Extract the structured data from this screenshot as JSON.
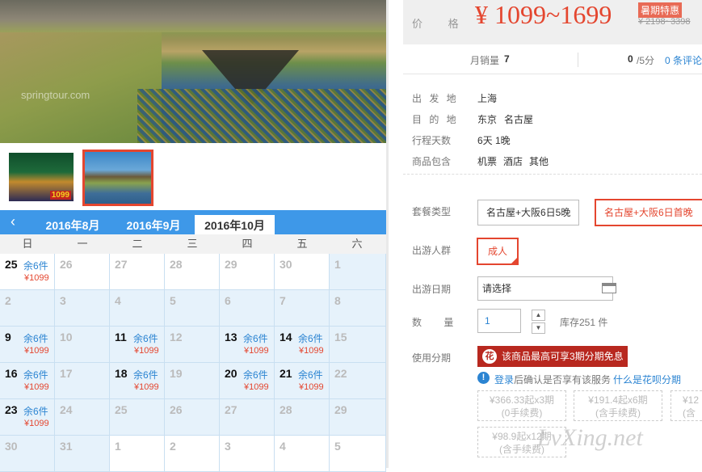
{
  "photo": {
    "watermark": "springtour.com"
  },
  "thumbs": [
    {
      "badge": "1099"
    },
    {
      "badge": ""
    }
  ],
  "calendar": {
    "tabs": [
      "2016年8月",
      "2016年9月",
      "2016年10月"
    ],
    "weekdays": [
      "日",
      "一",
      "二",
      "三",
      "四",
      "五",
      "六"
    ],
    "rows": [
      [
        {
          "d": "25",
          "s": "余6件",
          "p": "¥1099",
          "on": true,
          "w": true
        },
        {
          "d": "26",
          "w": true
        },
        {
          "d": "27",
          "w": true
        },
        {
          "d": "28",
          "w": true
        },
        {
          "d": "29",
          "w": true
        },
        {
          "d": "30",
          "w": true
        },
        {
          "d": "1"
        }
      ],
      [
        {
          "d": "2"
        },
        {
          "d": "3"
        },
        {
          "d": "4"
        },
        {
          "d": "5"
        },
        {
          "d": "6"
        },
        {
          "d": "7"
        },
        {
          "d": "8"
        }
      ],
      [
        {
          "d": "9",
          "s": "余6件",
          "p": "¥1099",
          "on": true
        },
        {
          "d": "10"
        },
        {
          "d": "11",
          "s": "余6件",
          "p": "¥1099",
          "on": true
        },
        {
          "d": "12"
        },
        {
          "d": "13",
          "s": "余6件",
          "p": "¥1099",
          "on": true
        },
        {
          "d": "14",
          "s": "余6件",
          "p": "¥1099",
          "on": true
        },
        {
          "d": "15"
        }
      ],
      [
        {
          "d": "16",
          "s": "余6件",
          "p": "¥1099",
          "on": true
        },
        {
          "d": "17"
        },
        {
          "d": "18",
          "s": "余6件",
          "p": "¥1099",
          "on": true
        },
        {
          "d": "19"
        },
        {
          "d": "20",
          "s": "余6件",
          "p": "¥1099",
          "on": true
        },
        {
          "d": "21",
          "s": "余6件",
          "p": "¥1099",
          "on": true
        },
        {
          "d": "22"
        }
      ],
      [
        {
          "d": "23",
          "s": "余6件",
          "p": "¥1099",
          "on": true
        },
        {
          "d": "24"
        },
        {
          "d": "25"
        },
        {
          "d": "26"
        },
        {
          "d": "27"
        },
        {
          "d": "28"
        },
        {
          "d": "29"
        }
      ],
      [
        {
          "d": "30"
        },
        {
          "d": "31"
        },
        {
          "d": "1",
          "w": true
        },
        {
          "d": "2",
          "w": true
        },
        {
          "d": "3",
          "w": true
        },
        {
          "d": "4",
          "w": true
        },
        {
          "d": "5",
          "w": true
        }
      ]
    ]
  },
  "price": {
    "label": "价 格",
    "value": "¥ 1099~1699",
    "promo": "暑期特惠",
    "original": "¥ 2198~3398"
  },
  "sales": {
    "label": "月销量",
    "count": "7",
    "score": "0",
    "score_unit": "/5分",
    "reviews": "0 条评论"
  },
  "info": [
    {
      "label": "出 发 地",
      "value": [
        "上海"
      ]
    },
    {
      "label": "目 的 地",
      "value": [
        "东京",
        "名古屋"
      ]
    },
    {
      "label": "行程天数",
      "value": [
        "6天 1晚"
      ]
    },
    {
      "label": "商品包含",
      "value": [
        "机票",
        "酒店",
        "其他"
      ]
    }
  ],
  "package": {
    "label": "套餐类型",
    "options": [
      "名古屋+大阪6日5晚",
      "名古屋+大阪6日首晚"
    ]
  },
  "crowd": {
    "label": "出游人群",
    "option": "成人"
  },
  "date": {
    "label": "出游日期",
    "placeholder": "请选择"
  },
  "qty": {
    "label": "数 量",
    "value": "1",
    "stock": "库存251 件"
  },
  "installment": {
    "label": "使用分期",
    "banner": "该商品最高可享3期分期免息",
    "login_text": "登录",
    "notice": "后确认是否享有该服务",
    "link": "什么是花呗分期",
    "options": [
      {
        "l1": "¥366.33起x3期",
        "l2": "(0手续费)"
      },
      {
        "l1": "¥191.4起x6期",
        "l2": "(含手续费)"
      },
      {
        "l1": "¥12",
        "l2": "(含"
      },
      {
        "l1": "¥98.9起x12期",
        "l2": "(含手续费)"
      }
    ]
  },
  "watermark": "LvXing.net",
  "colors": {
    "accent": "#e4462f",
    "calendar_blue": "#3e98e8",
    "link": "#2b84d2"
  }
}
